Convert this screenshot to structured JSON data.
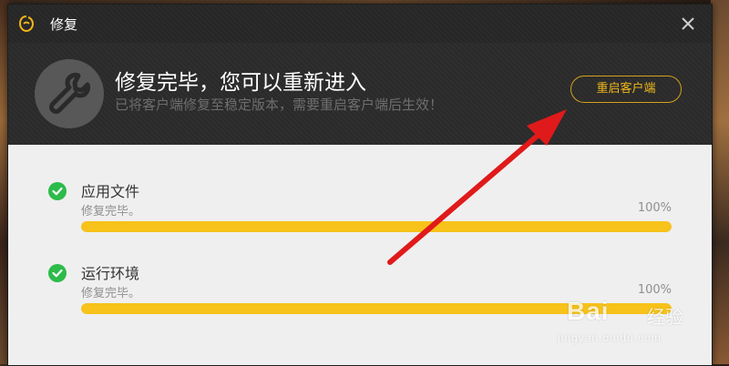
{
  "window": {
    "title": "修复"
  },
  "header": {
    "heading": "修复完毕，您可以重新进入",
    "subheading": "已将客户端修复至稳定版本，需要重启客户端后生效！",
    "restart_button_label": "重启客户端"
  },
  "items": [
    {
      "name": "应用文件",
      "status": "修复完毕。",
      "percent_text": "100%",
      "progress": 1.0
    },
    {
      "name": "运行环境",
      "status": "修复完毕。",
      "percent_text": "100%",
      "progress": 1.0
    }
  ],
  "watermark": {
    "brand": "Bai",
    "brand_suffix": "经验",
    "url": "jingyan.baidu.com"
  },
  "colors": {
    "accent": "#f7c21a",
    "success": "#2dbb4a",
    "arrow": "#e01a1a",
    "header_bg": "#2b2b2b"
  },
  "icons": {
    "logo": "egg-logo-icon",
    "close": "close-icon",
    "wrench": "wrench-icon",
    "check": "check-circle-icon",
    "arrow": "red-annotation-arrow"
  }
}
